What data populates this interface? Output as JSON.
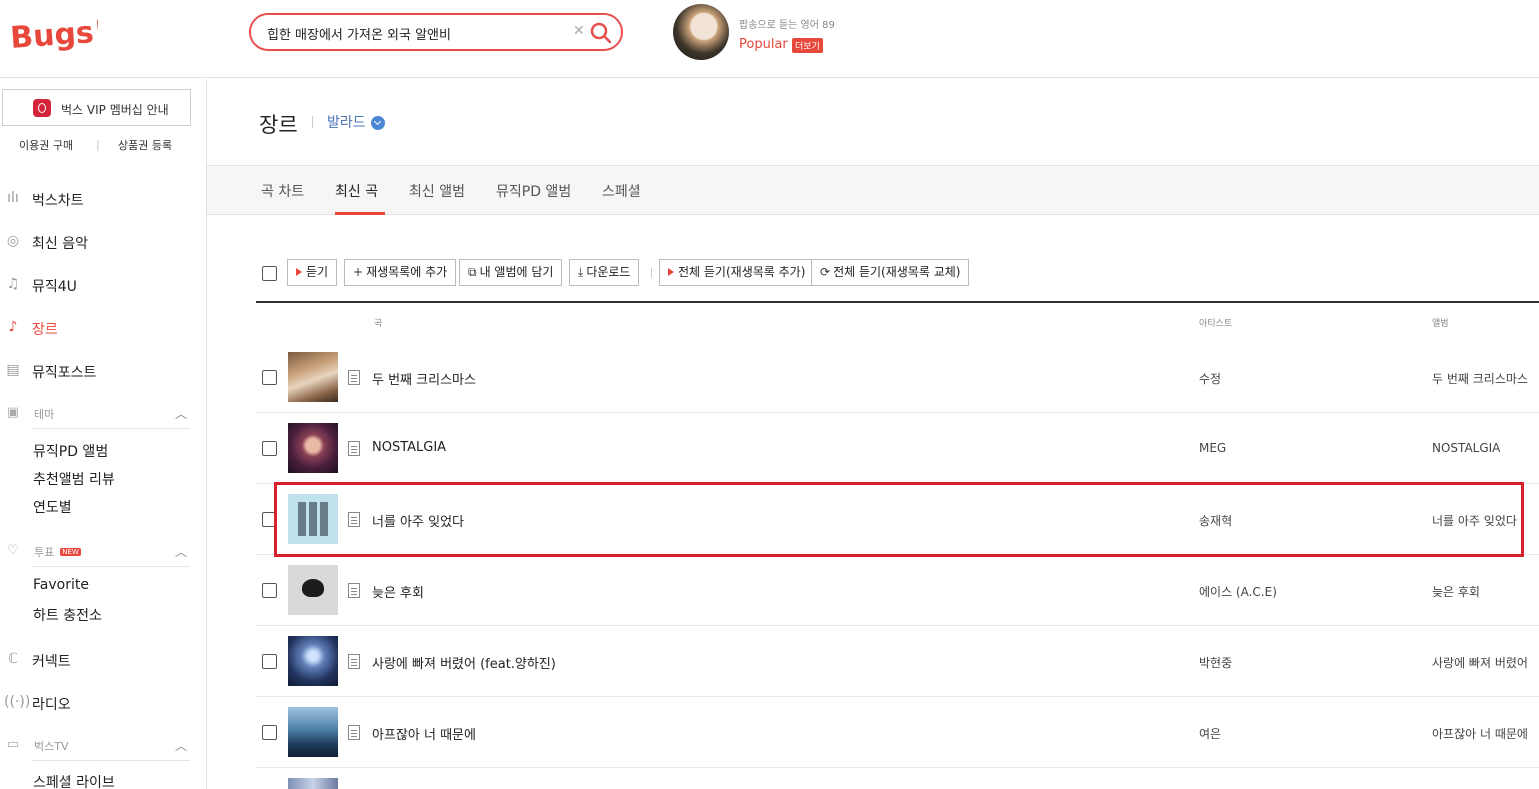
{
  "header": {
    "logo_text": "Bugs!",
    "search_value": "힙한 매장에서 가져온 외국 알앤비",
    "promo_subtitle": "팝송으로 듣는 영어 89",
    "promo_title": "Popular",
    "promo_more": "더보기"
  },
  "sidebar": {
    "vip_label": "벅스 VIP 멤버십 안내",
    "buy_link": "이용권 구매",
    "voucher_link": "상품권 등록",
    "nav": [
      "벅스차트",
      "최신 음악",
      "뮤직4U",
      "장르",
      "뮤직포스트"
    ],
    "theme": {
      "label": "테마",
      "items": [
        "뮤직PD 앨범",
        "추천앨범 리뷰",
        "연도별"
      ]
    },
    "vote": {
      "label": "투표",
      "badge": "NEW",
      "items": [
        "Favorite",
        "하트 충전소"
      ]
    },
    "nav2": [
      "커넥트",
      "라디오"
    ],
    "tv": {
      "label": "벅스TV",
      "items": [
        "스페셜 라이브"
      ]
    }
  },
  "main": {
    "title": "장르",
    "genre": "발라드",
    "tabs": [
      "곡 차트",
      "최신 곡",
      "최신 앨범",
      "뮤직PD 앨범",
      "스페셜"
    ],
    "active_tab": 1,
    "toolbar": {
      "play": "듣기",
      "add_playlist": "재생목록에 추가",
      "add_album": "내 앨범에 담기",
      "download": "다운로드",
      "play_all_add": "전체 듣기(재생목록 추가)",
      "play_all_replace": "전체 듣기(재생목록 교체)"
    },
    "columns": {
      "song": "곡",
      "artist": "아티스트",
      "album": "앨범"
    },
    "rows": [
      {
        "title": "두 번째 크리스마스",
        "artist": "수정",
        "album": "두 번째 크리스마스"
      },
      {
        "title": "NOSTALGIA",
        "artist": "MEG",
        "album": "NOSTALGIA"
      },
      {
        "title": "너를 아주 잊었다",
        "artist": "송재혁",
        "album": "너를 아주 잊었다"
      },
      {
        "title": "늦은 후회",
        "artist": "에이스 (A.C.E)",
        "album": "늦은 후회"
      },
      {
        "title": "사랑에 빠져 버렸어 (feat.양하진)",
        "artist": "박현중",
        "album": "사랑에 빠져 버렸어"
      },
      {
        "title": "아프잖아 너 때문에",
        "artist": "여은",
        "album": "아프잖아 너 때문에"
      }
    ]
  },
  "colors": {
    "brand": "#e8473c",
    "highlight": "#d8202b",
    "link": "#4b74b8"
  }
}
